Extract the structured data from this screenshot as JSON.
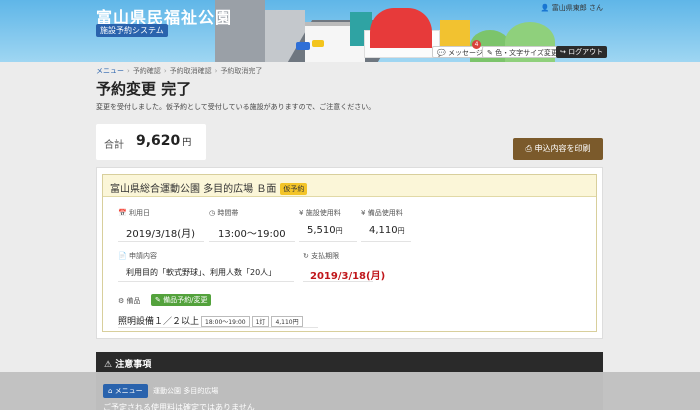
{
  "header": {
    "site_name": "富山県民福祉公園",
    "system_name": "施設予約システム",
    "user": "富山県東郎 さん",
    "message_label": "メッセージ",
    "message_count": "4",
    "color_label": "色・文字サイズ変更",
    "logout_label": "ログアウト"
  },
  "breadcrumb": [
    "メニュー",
    "予約確認",
    "予約取消確認",
    "予約取消完了"
  ],
  "title": "予約変更 完了",
  "notice": "変更を受付しました。仮予約として受付している施設がありますので、ご注意ください。",
  "total": {
    "label": "合計",
    "value": "9,620",
    "unit": "円"
  },
  "print_label": "申込内容を印刷",
  "reservation": {
    "facility": "富山県総合運動公園 多目的広場 Ｂ面",
    "status_tag": "仮予約",
    "date_label": "利用日",
    "date": "2019/3/18(月)",
    "time_label": "時間帯",
    "time": "13:00～19:00",
    "facility_fee_label": "施設使用料",
    "facility_fee": "5,510",
    "equip_fee_label": "備品使用料",
    "equip_fee": "4,110",
    "yen": "円",
    "content_label": "申請内容",
    "content": "利用目的「軟式野球」、利用人数「20人」",
    "deadline_label": "支払期限",
    "deadline": "2019/3/18(月)",
    "equipment_label": "備品",
    "equipment_btn": "備品予約/変更",
    "equipment_item": "照明設備１／２以上",
    "equipment_time": "18:00～19:00",
    "equipment_qty": "1灯",
    "equipment_price": "4,110円"
  },
  "caution_title": "注意事項",
  "bottom": {
    "menu_label": "メニュー",
    "text1": "運動公園 多目的広場",
    "text2": "ご予定される使用料は確定ではありません"
  },
  "colors": {
    "accent": "#2a63ad",
    "print": "#7b5a2b",
    "deadline": "#c0161b",
    "equip_btn": "#53a23c"
  }
}
